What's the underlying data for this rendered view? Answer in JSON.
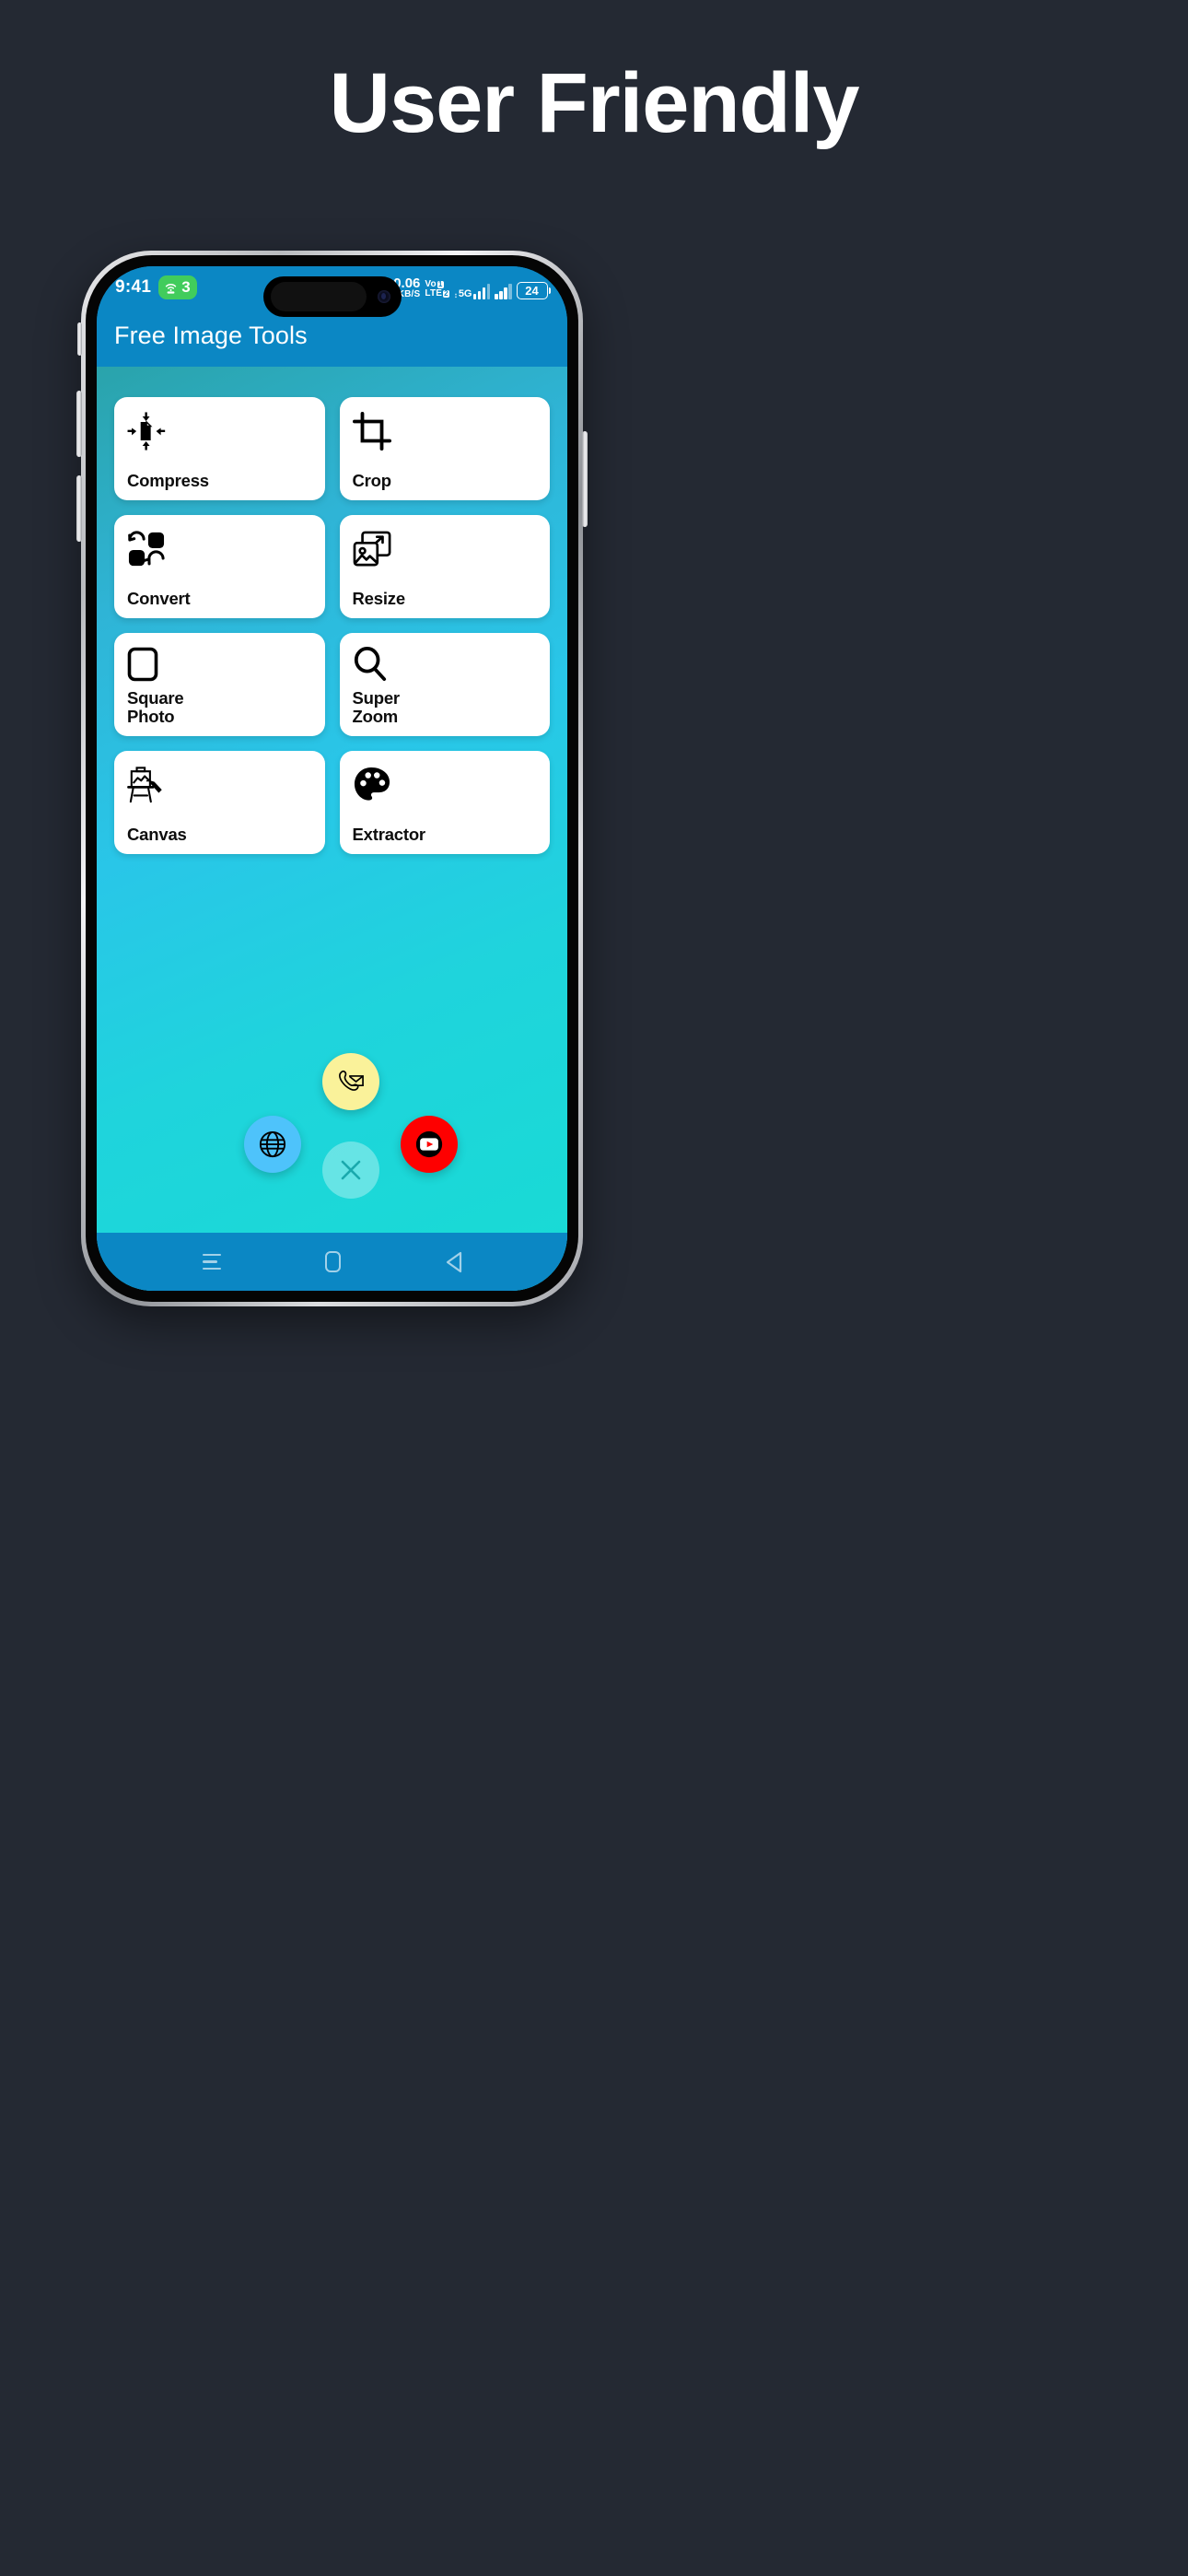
{
  "headline": "User Friendly",
  "colors": {
    "page_background": "#242933",
    "app_bar": "#0b87c4",
    "gradient_top": "#2aa3ab",
    "gradient_bottom": "#18dbd4",
    "card_background": "#ffffff",
    "wifi_chip": "#41cc5c",
    "fab_contact": "#faf29a",
    "fab_web": "#4ec3fb",
    "fab_youtube": "#fe0000",
    "fab_pink": "#cc2cc4",
    "fab_grey": "#cfcfcf"
  },
  "status_bar": {
    "clock": "9:41",
    "wifi_icon": "wifi-hotspot-icon",
    "wifi_count": "3",
    "net_speed_value": "0.06",
    "net_speed_unit": "KB/S",
    "volte_line1": "Vo",
    "volte_badge1": "1",
    "volte_line2": "LTE",
    "volte_badge2": "2",
    "network_type": "5G",
    "battery_percent": "24"
  },
  "app_bar": {
    "title": "Free Image Tools"
  },
  "tools": [
    {
      "label": "Compress",
      "icon": "compress-icon",
      "lines": 1
    },
    {
      "label": "Crop",
      "icon": "crop-icon",
      "lines": 1
    },
    {
      "label": "Convert",
      "icon": "convert-icon",
      "lines": 1
    },
    {
      "label": "Resize",
      "icon": "resize-icon",
      "lines": 1
    },
    {
      "label": "Square\nPhoto",
      "icon": "square-photo-icon",
      "lines": 2
    },
    {
      "label": "Super\nZoom",
      "icon": "super-zoom-icon",
      "lines": 2
    },
    {
      "label": "Canvas",
      "icon": "canvas-easel-icon",
      "lines": 1
    },
    {
      "label": "Extractor",
      "icon": "color-palette-icon",
      "lines": 1
    }
  ],
  "fab_menu": [
    {
      "name": "contact",
      "icon": "phone-envelope-icon"
    },
    {
      "name": "website",
      "icon": "globe-icon"
    },
    {
      "name": "youtube",
      "icon": "youtube-icon"
    },
    {
      "name": "close",
      "icon": "close-x-icon"
    },
    {
      "name": "pink",
      "icon": "partial-circle-icon"
    },
    {
      "name": "grey",
      "icon": "partial-circle-icon"
    }
  ],
  "nav_bar": {
    "recents": "menu-icon",
    "home": "home-icon",
    "back": "back-icon"
  }
}
